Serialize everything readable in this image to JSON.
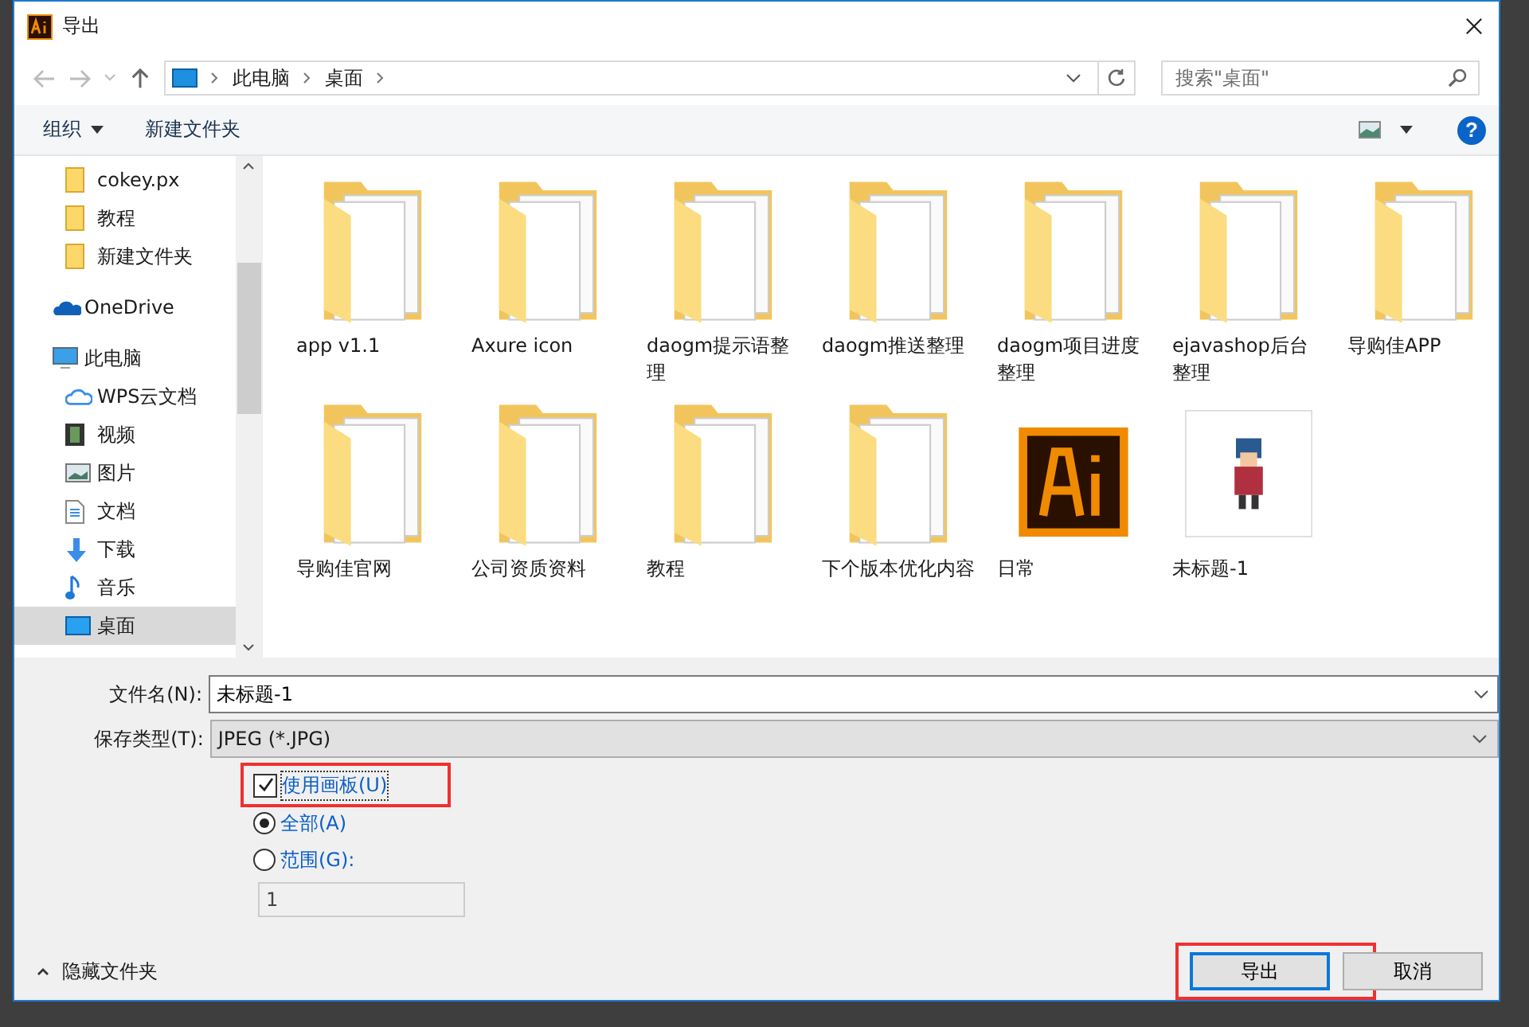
{
  "window": {
    "title": "导出"
  },
  "nav": {
    "path": [
      "此电脑",
      "桌面"
    ],
    "search": {
      "placeholder": "搜索\"桌面\""
    }
  },
  "toolbar": {
    "organize": "组织",
    "new_folder": "新建文件夹",
    "help": "?"
  },
  "sidebar": {
    "pinned": [
      {
        "label": "cokey.px",
        "kind": "folder",
        "selected": false
      },
      {
        "label": "教程",
        "kind": "folder",
        "selected": false
      },
      {
        "label": "新建文件夹",
        "kind": "folder",
        "selected": false
      }
    ],
    "items": [
      {
        "label": "OneDrive",
        "kind": "onedrive",
        "selected": false
      },
      {
        "label": "此电脑",
        "kind": "pc",
        "selected": false,
        "children": [
          {
            "label": "WPS云文档",
            "kind": "cloud",
            "selected": false
          },
          {
            "label": "视频",
            "kind": "video",
            "selected": false
          },
          {
            "label": "图片",
            "kind": "picture",
            "selected": false
          },
          {
            "label": "文档",
            "kind": "document",
            "selected": false
          },
          {
            "label": "下载",
            "kind": "download",
            "selected": false
          },
          {
            "label": "音乐",
            "kind": "music",
            "selected": false
          },
          {
            "label": "桌面",
            "kind": "desktop",
            "selected": true
          }
        ]
      }
    ]
  },
  "files": [
    {
      "name": "app v1.1",
      "kind": "folder"
    },
    {
      "name": "Axure icon",
      "kind": "folder"
    },
    {
      "name": "daogm提示语整理",
      "kind": "folder"
    },
    {
      "name": "daogm推送整理",
      "kind": "folder"
    },
    {
      "name": "daogm项目进度整理",
      "kind": "folder"
    },
    {
      "name": "ejavashop后台整理",
      "kind": "folder"
    },
    {
      "name": "导购佳APP",
      "kind": "folder"
    },
    {
      "name": "导购佳官网",
      "kind": "folder"
    },
    {
      "name": "公司资质资料",
      "kind": "folder"
    },
    {
      "name": "教程",
      "kind": "folder"
    },
    {
      "name": "下个版本优化内容",
      "kind": "folder"
    },
    {
      "name": "日常",
      "kind": "ai-file"
    },
    {
      "name": "未标题-1",
      "kind": "image"
    }
  ],
  "form": {
    "filename": {
      "label": "文件名(N):",
      "value": "未标题-1"
    },
    "filetype": {
      "label": "保存类型(T):",
      "value": "JPEG (*.JPG)"
    },
    "artboards": {
      "label": "使用画板(U)",
      "checked": true,
      "highlighted": true
    },
    "range_options": [
      {
        "label": "全部(A)",
        "selected": true
      },
      {
        "label": "范围(G):",
        "selected": false
      }
    ],
    "range_field": {
      "value": "1",
      "disabled": true
    }
  },
  "footer": {
    "hide_folders": "隐藏文件夹",
    "buttons": [
      {
        "label": "导出",
        "default": true,
        "highlighted": true
      },
      {
        "label": "取消",
        "default": false,
        "highlighted": false
      }
    ]
  }
}
